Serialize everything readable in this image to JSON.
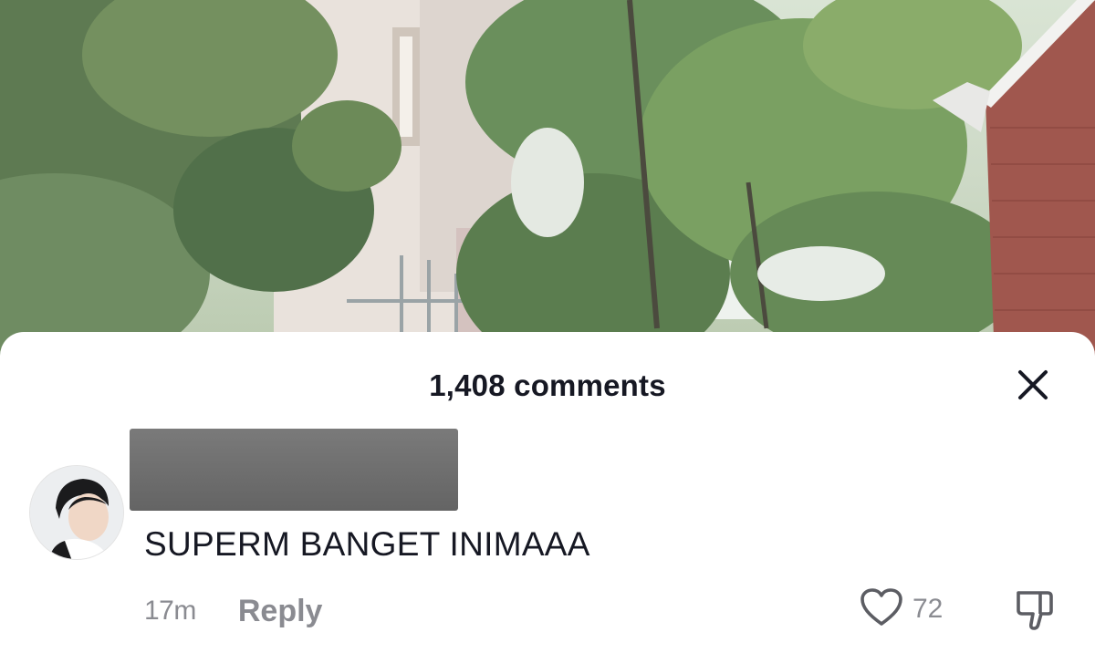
{
  "sheet": {
    "title": "1,408 comments"
  },
  "comment": {
    "text": "SUPERM BANGET INIMAAA",
    "time": "17m",
    "reply_label": "Reply",
    "like_count": "72"
  },
  "icons": {
    "close": "close-icon",
    "like": "heart-icon",
    "dislike": "thumbs-down-icon"
  },
  "colors": {
    "primary_text": "#161823",
    "secondary_text": "#8a8b91"
  }
}
